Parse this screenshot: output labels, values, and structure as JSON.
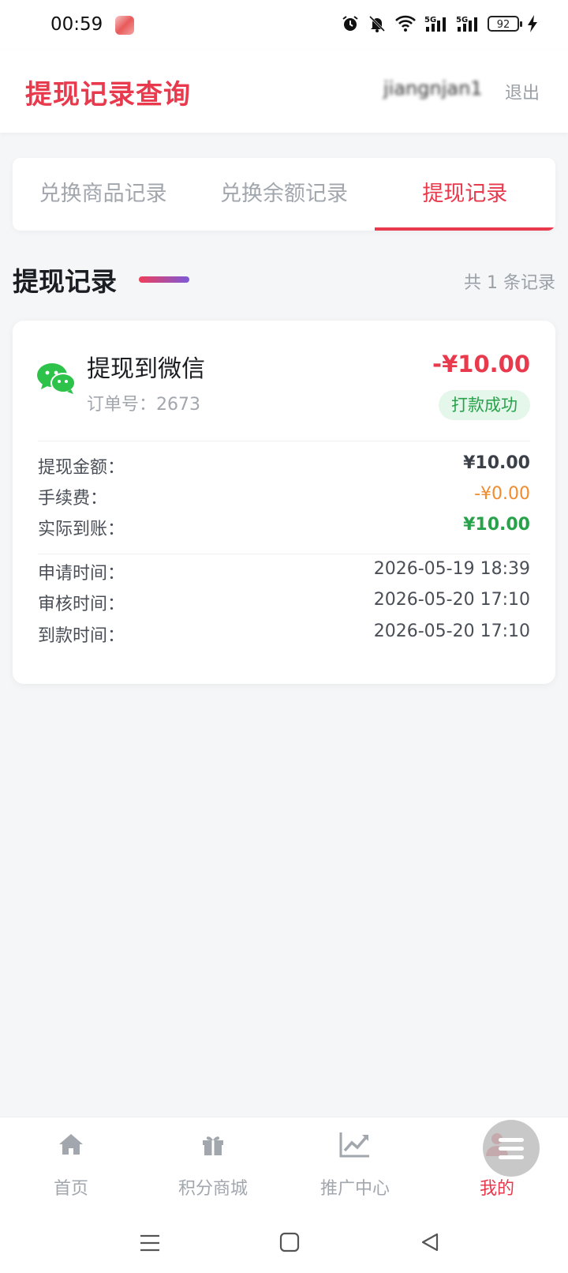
{
  "status_bar": {
    "time": "00:59",
    "battery": "92"
  },
  "header": {
    "title": "提现记录查询",
    "username": "jiangnjan1",
    "logout": "退出"
  },
  "tabs": [
    {
      "label": "兑换商品记录",
      "active": false
    },
    {
      "label": "兑换余额记录",
      "active": false
    },
    {
      "label": "提现记录",
      "active": true
    }
  ],
  "section": {
    "title": "提现记录",
    "count_text": "共 1 条记录"
  },
  "record": {
    "icon": "wechat-icon",
    "title": "提现到微信",
    "order_label": "订单号：",
    "order_no": "2673",
    "amount": "-¥10.00",
    "status": "打款成功",
    "details": [
      {
        "label": "提现金额：",
        "value": "¥10.00"
      },
      {
        "label": "手续费：",
        "value": "-¥0.00"
      },
      {
        "label": "实际到账：",
        "value": "¥10.00"
      }
    ],
    "times": [
      {
        "label": "申请时间：",
        "value": "2026-05-19 18:39"
      },
      {
        "label": "审核时间：",
        "value": "2026-05-20 17:10"
      },
      {
        "label": "到款时间：",
        "value": "2026-05-20 17:10"
      }
    ]
  },
  "bottom_nav": [
    {
      "label": "首页",
      "icon": "home-icon",
      "active": false
    },
    {
      "label": "积分商城",
      "icon": "gift-icon",
      "active": false
    },
    {
      "label": "推广中心",
      "icon": "trend-chart-icon",
      "active": false
    },
    {
      "label": "我的",
      "icon": "user-icon",
      "active": true
    }
  ],
  "colors": {
    "accent": "#e8394d",
    "success": "#27a24a",
    "fee": "#f08c2e",
    "wechat": "#2dc24a"
  }
}
